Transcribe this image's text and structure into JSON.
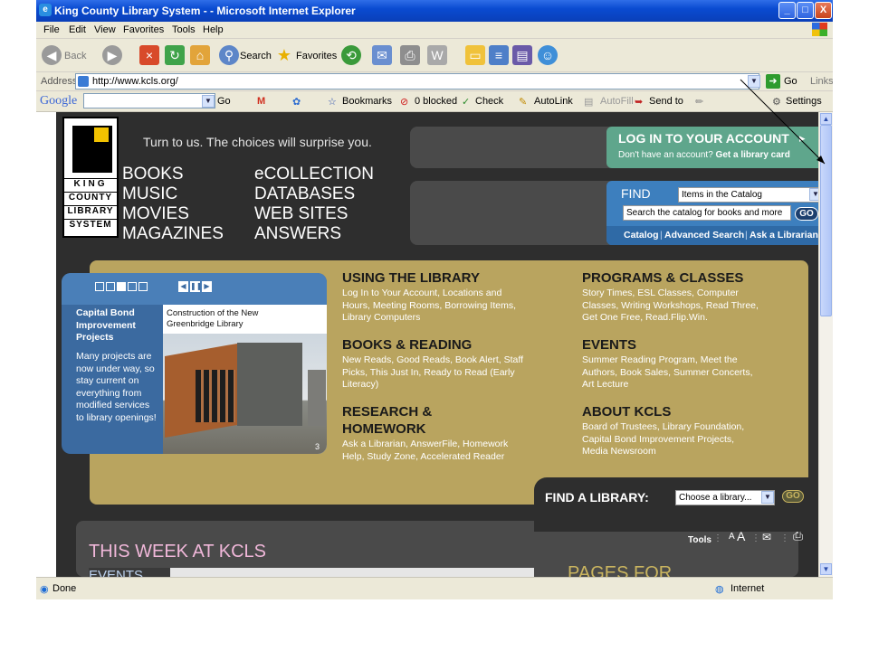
{
  "window": {
    "title": "King County Library System - - Microsoft Internet Explorer",
    "buttons": {
      "minimize": "_",
      "maximize": "□",
      "close": "X"
    }
  },
  "menu": [
    "File",
    "Edit",
    "View",
    "Favorites",
    "Tools",
    "Help"
  ],
  "toolbar": {
    "back": "Back",
    "search": "Search",
    "favorites": "Favorites"
  },
  "address": {
    "label": "Address",
    "url": "http://www.kcls.org/",
    "go": "Go",
    "links": "Links"
  },
  "googlebar": {
    "logo": "Google",
    "go": "Go",
    "bookmarks": "Bookmarks",
    "blocked": "0 blocked",
    "check": "Check",
    "autolink": "AutoLink",
    "autofill": "AutoFill",
    "sendto": "Send to",
    "settings": "Settings"
  },
  "page": {
    "logo_lines": [
      "KING",
      "COUNTY",
      "LIBRARY",
      "SYSTEM"
    ],
    "tagline": "Turn to us. The choices will surprise you.",
    "nav_left": [
      "BOOKS",
      "MUSIC",
      "MOVIES",
      "MAGAZINES"
    ],
    "nav_right": [
      "eCOLLECTION",
      "DATABASES",
      "WEB SITES",
      "ANSWERS"
    ],
    "login": {
      "title": "LOG IN TO YOUR ACCOUNT",
      "sub_prefix": "Don't have an account?",
      "sub_link": "Get a library card"
    },
    "find": {
      "label": "FIND",
      "select": "Items in the Catalog",
      "input": "Search the catalog for books and more",
      "go": "GO",
      "links": [
        "Catalog",
        "Advanced Search",
        "Ask a Librarian"
      ]
    },
    "feature": {
      "title": "Capital Bond Improvement Projects",
      "body": "Many projects are now under way, so stay current on everything from modified services to library openings!",
      "caption": "Construction of the New Greenbridge Library",
      "page": "3"
    },
    "sections": [
      {
        "title": "USING THE LIBRARY",
        "text": "Log In to Your Account, Locations and Hours, Meeting Rooms, Borrowing Items, Library Computers"
      },
      {
        "title": "PROGRAMS & CLASSES",
        "text": "Story Times, ESL Classes, Computer Classes, Writing Workshops, Read Three, Get One Free, Read.Flip.Win."
      },
      {
        "title": "BOOKS & READING",
        "text": "New Reads, Good Reads, Book Alert, Staff Picks, This Just In, Ready to Read (Early Literacy)"
      },
      {
        "title": "EVENTS",
        "text": "Summer Reading Program, Meet the Authors, Book Sales, Summer Concerts, Art Lecture"
      },
      {
        "title": "RESEARCH & HOMEWORK",
        "text": "Ask a Librarian, AnswerFile, Homework Help, Study Zone, Accelerated Reader"
      },
      {
        "title": "ABOUT KCLS",
        "text": "Board of Trustees, Library Foundation, Capital Bond Improvement Projects, Media Newsroom"
      }
    ],
    "findlib": {
      "label": "FIND A LIBRARY:",
      "select": "Choose a library...",
      "go": "GO"
    },
    "this_week": "THIS WEEK AT KCLS",
    "events_tab": "EVENTS",
    "pages_for": "PAGES FOR",
    "tools": "Tools"
  },
  "status": {
    "text": "Done",
    "zone": "Internet"
  }
}
